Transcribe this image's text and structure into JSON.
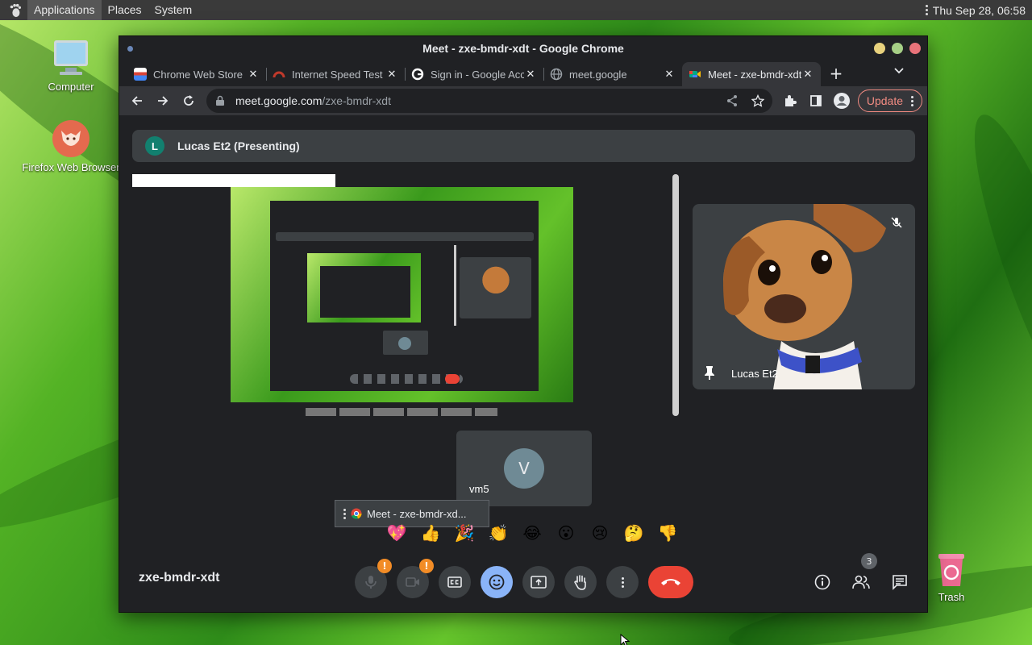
{
  "top_panel": {
    "menus": [
      "Applications",
      "Places",
      "System"
    ],
    "clock": "Thu Sep 28, 06:58"
  },
  "desktop": {
    "icons": [
      {
        "label": "Computer"
      },
      {
        "label": "Firefox Web Browser"
      },
      {
        "label": "Trash"
      }
    ]
  },
  "window": {
    "title": "Meet - zxe-bmdr-xdt - Google Chrome"
  },
  "tabs": [
    {
      "title": "Chrome Web Store",
      "icon": "chrome-web-store-icon"
    },
    {
      "title": "Internet Speed Test",
      "icon": "speedtest-icon"
    },
    {
      "title": "Sign in - Google Accounts",
      "icon": "google-icon"
    },
    {
      "title": "meet.google",
      "icon": "globe-icon"
    },
    {
      "title": "Meet - zxe-bmdr-xdt",
      "icon": "meet-icon",
      "active": true
    }
  ],
  "toolbar": {
    "url_host": "meet.google.com",
    "url_path": "/zxe-bmdr-xdt",
    "update_label": "Update"
  },
  "meet": {
    "presenter": {
      "initial": "L",
      "label": "Lucas Et2 (Presenting)"
    },
    "participants": [
      {
        "name": "Lucas Et2",
        "muted": true,
        "pinned": true
      },
      {
        "name": "vm5",
        "initial": "V"
      }
    ],
    "tooltip": "Meet - zxe-bmdr-xd...",
    "reactions": [
      "💖",
      "👍",
      "🎉",
      "👏",
      "😂",
      "😮",
      "😢",
      "🤔",
      "👎"
    ],
    "meeting_code": "zxe-bmdr-xdt",
    "people_count": "3",
    "mic_badge": "!",
    "cam_badge": "!"
  },
  "colors": {
    "end_call": "#ea4335",
    "emoji_active": "#8ab4f8",
    "update_accent": "#f28b82",
    "badge": "#f28c26"
  }
}
